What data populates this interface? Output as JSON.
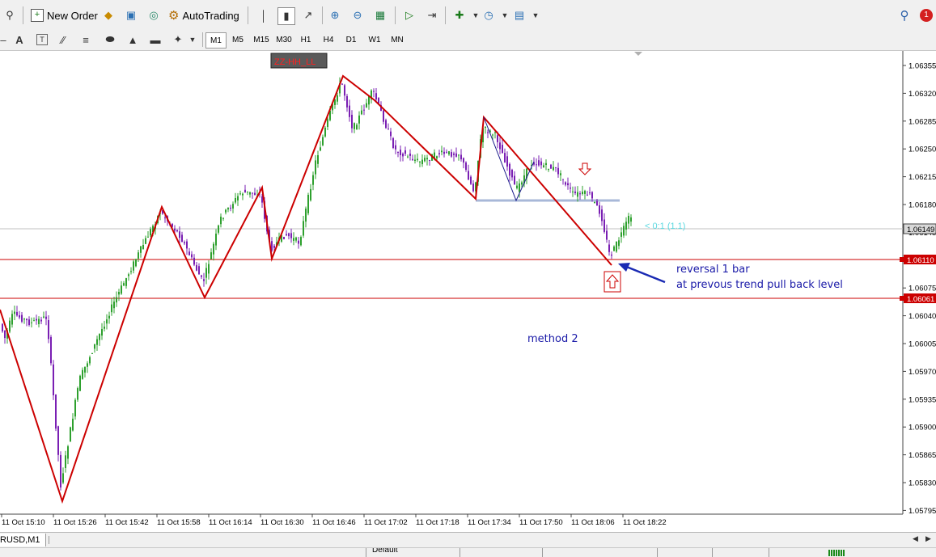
{
  "toolbar": {
    "new_order_label": "New Order",
    "autotrading_label": "AutoTrading",
    "notification_count": "1"
  },
  "timeframes": [
    "M1",
    "M5",
    "M15",
    "M30",
    "H1",
    "H4",
    "D1",
    "W1",
    "MN"
  ],
  "active_timeframe": "M1",
  "drawing_tools": {
    "text_label": "A",
    "text_label_tool": "T"
  },
  "chart": {
    "indicator_label": "ZZ-HH_LL",
    "price_axis": [
      "1.06355",
      "1.06320",
      "1.06285",
      "1.06250",
      "1.06215",
      "1.06180",
      "1.06145",
      "1.06110",
      "1.06075",
      "1.06040",
      "1.06005",
      "1.05970",
      "1.05935",
      "1.05900",
      "1.05865",
      "1.05830",
      "1.05795"
    ],
    "current_price_tag": "1.06149",
    "level_tags": [
      "1.06110",
      "1.06061"
    ],
    "time_axis": [
      "11 Oct 15:10",
      "11 Oct 15:26",
      "11 Oct 15:42",
      "11 Oct 15:58",
      "11 Oct 16:14",
      "11 Oct 16:30",
      "11 Oct 16:46",
      "11 Oct 17:02",
      "11 Oct 17:18",
      "11 Oct 17:34",
      "11 Oct 17:50",
      "11 Oct 18:06",
      "11 Oct 18:22"
    ],
    "projection_label": "< 0:1 (1.1)",
    "annotation_line1": "reversal 1 bar",
    "annotation_line2": "at prevous trend pull back level",
    "method_label": "method 2",
    "colors": {
      "zigzag": "#cc0000",
      "bull_bar": "#2ea02e",
      "bear_bar": "#7a1fb3",
      "level_line": "#cc0000",
      "pullback_line": "#a8b8d8",
      "annotation": "#1a1aa8"
    }
  },
  "bottom": {
    "symbol_tab": "RUSD,M1",
    "status_text": "Default"
  }
}
